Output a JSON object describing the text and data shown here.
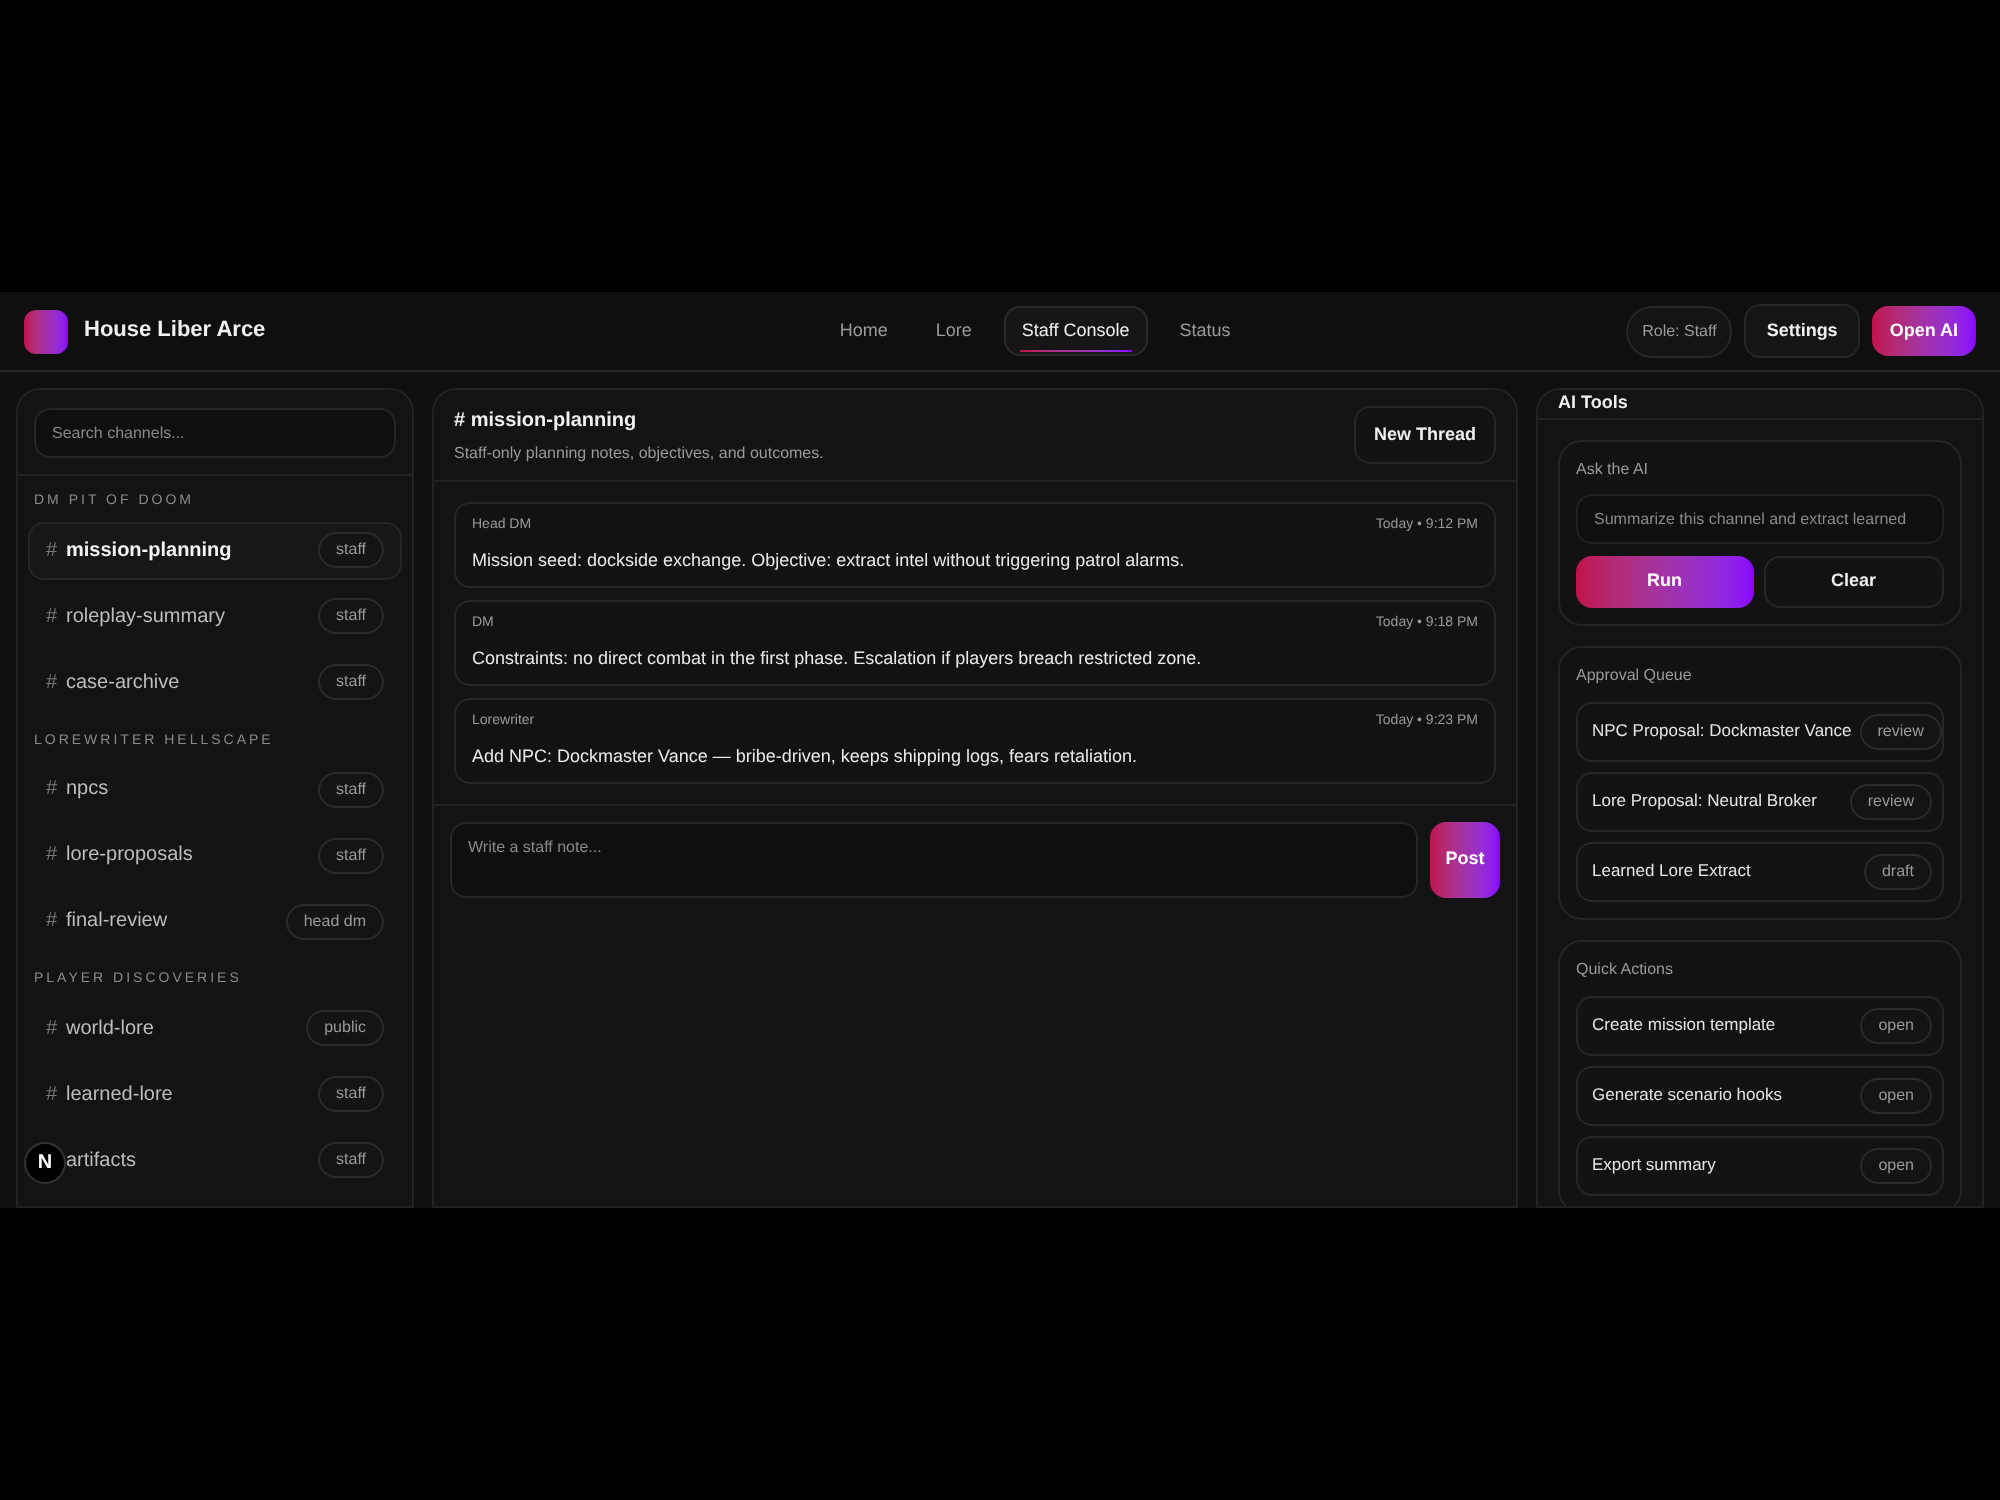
{
  "header": {
    "logo_title": "House Liber Arce",
    "nav": [
      {
        "label": "Home",
        "selected": false
      },
      {
        "label": "Lore",
        "selected": false
      },
      {
        "label": "Staff Console",
        "selected": true
      },
      {
        "label": "Status",
        "selected": false
      }
    ],
    "role": "Role: Staff",
    "settings": "Settings",
    "open_ai": "Open AI"
  },
  "sidebar": {
    "search": {
      "placeholder": "Search channels..."
    },
    "groups": [
      {
        "title": "DM PIT OF DOOM",
        "channels": [
          {
            "prefix": "#",
            "name": "mission-planning",
            "tag": "staff",
            "selected": true
          },
          {
            "prefix": "#",
            "name": "roleplay-summary",
            "tag": "staff",
            "selected": false
          },
          {
            "prefix": "#",
            "name": "case-archive",
            "tag": "staff",
            "selected": false
          }
        ]
      },
      {
        "title": "LOREWRITER HELLSCAPE",
        "channels": [
          {
            "prefix": "#",
            "name": "npcs",
            "tag": "staff",
            "selected": false
          },
          {
            "prefix": "#",
            "name": "lore-proposals",
            "tag": "staff",
            "selected": false
          },
          {
            "prefix": "#",
            "name": "final-review",
            "tag": "head dm",
            "selected": false
          }
        ]
      },
      {
        "title": "PLAYER DISCOVERIES",
        "channels": [
          {
            "prefix": "#",
            "name": "world-lore",
            "tag": "public",
            "selected": false
          },
          {
            "prefix": "#",
            "name": "learned-lore",
            "tag": "staff",
            "selected": false
          },
          {
            "name": "artifacts",
            "tag": "staff",
            "selected": false
          }
        ]
      }
    ]
  },
  "channel": {
    "title": "# mission-planning",
    "description": "Staff-only planning notes, objectives, and outcomes.",
    "new_thread": "New Thread",
    "messages": [
      {
        "author": "Head DM",
        "time": "Today • 9:12 PM",
        "text": "Mission seed: dockside exchange. Objective: extract intel without triggering patrol alarms."
      },
      {
        "author": "DM",
        "time": "Today • 9:18 PM",
        "text": "Constraints: no direct combat in the first phase. Escalation if players breach restricted zone."
      },
      {
        "author": "Lorewriter",
        "time": "Today • 9:23 PM",
        "text": "Add NPC: Dockmaster Vance — bribe-driven, keeps shipping logs, fears retaliation."
      }
    ],
    "composer": {
      "placeholder": "Write a staff note..."
    },
    "post": "Post"
  },
  "ai_tools": {
    "title": "AI Tools",
    "ask": {
      "label": "Ask the AI",
      "placeholder": "Summarize this channel and extract learned",
      "run": "Run",
      "clear": "Clear"
    },
    "approval": {
      "title": "Approval Queue",
      "items": [
        {
          "label": "NPC Proposal: Dockmaster Vance",
          "tag": "review"
        },
        {
          "label": "Lore Proposal: Neutral Broker",
          "tag": "review"
        },
        {
          "label": "Learned Lore Extract",
          "tag": "draft"
        }
      ]
    },
    "quick": {
      "title": "Quick Actions",
      "items": [
        {
          "label": "Create mission template",
          "tag": "open"
        },
        {
          "label": "Generate scenario hooks",
          "tag": "open"
        },
        {
          "label": "Export summary",
          "tag": "open"
        }
      ]
    }
  },
  "dev_badge": "N"
}
